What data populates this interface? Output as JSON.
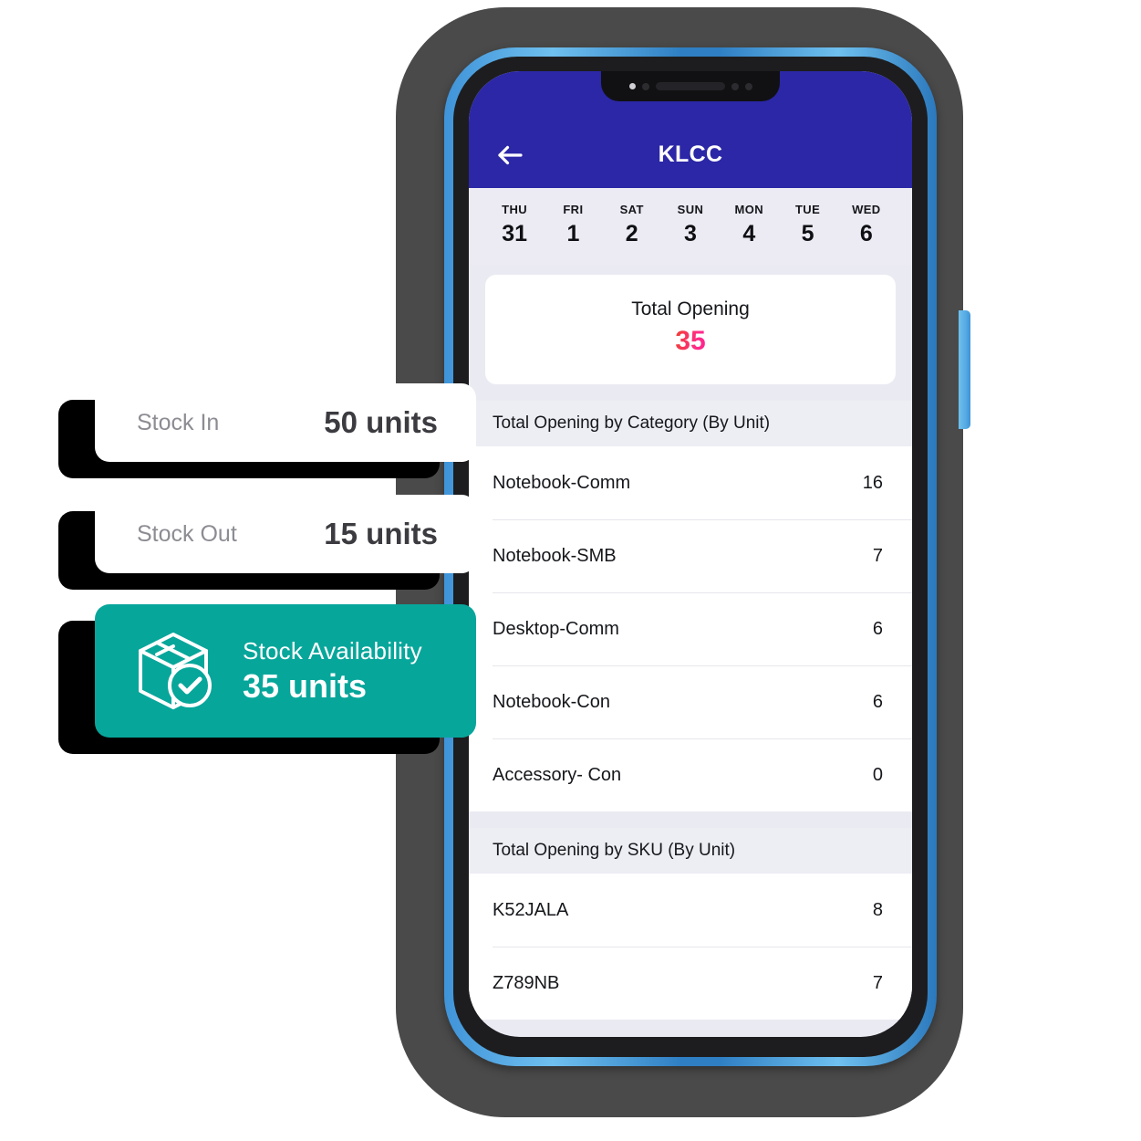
{
  "device": {
    "frame_color": "#3f93d8",
    "bezel_color": "#1d1d1f",
    "backdrop_color": "#4a4a4a"
  },
  "app": {
    "accent_blue": "#2b27a6",
    "accent_teal": "#07a69b",
    "screen_bg": "#eaeaf2",
    "appbar": {
      "title": "KLCC",
      "back_icon": "arrow-left-icon"
    },
    "date_strip": [
      {
        "dow": "THU",
        "num": "31"
      },
      {
        "dow": "FRI",
        "num": "1"
      },
      {
        "dow": "SAT",
        "num": "2"
      },
      {
        "dow": "SUN",
        "num": "3"
      },
      {
        "dow": "MON",
        "num": "4"
      },
      {
        "dow": "TUE",
        "num": "5"
      },
      {
        "dow": "WED",
        "num": "6"
      }
    ],
    "total_card": {
      "label": "Total Opening",
      "value": "35",
      "value_gradient_from": "#f0412f",
      "value_gradient_to": "#ff1f90"
    },
    "category_section": {
      "header": "Total Opening by Category (By Unit)",
      "rows": [
        {
          "label": "Notebook-Comm",
          "value": "16"
        },
        {
          "label": "Notebook-SMB",
          "value": "7"
        },
        {
          "label": "Desktop-Comm",
          "value": "6"
        },
        {
          "label": "Notebook-Con",
          "value": "6"
        },
        {
          "label": "Accessory- Con",
          "value": "0"
        }
      ]
    },
    "sku_section": {
      "header": "Total Opening by SKU (By Unit)",
      "rows": [
        {
          "label": "K52JALA",
          "value": "8"
        },
        {
          "label": "Z789NB",
          "value": "7"
        }
      ]
    }
  },
  "overlay_cards": {
    "stock_in": {
      "label": "Stock In",
      "value": "50 units"
    },
    "stock_out": {
      "label": "Stock Out",
      "value": "15 units"
    },
    "availability": {
      "label": "Stock Availability",
      "value": "35 units",
      "icon": "box-check-icon"
    }
  }
}
